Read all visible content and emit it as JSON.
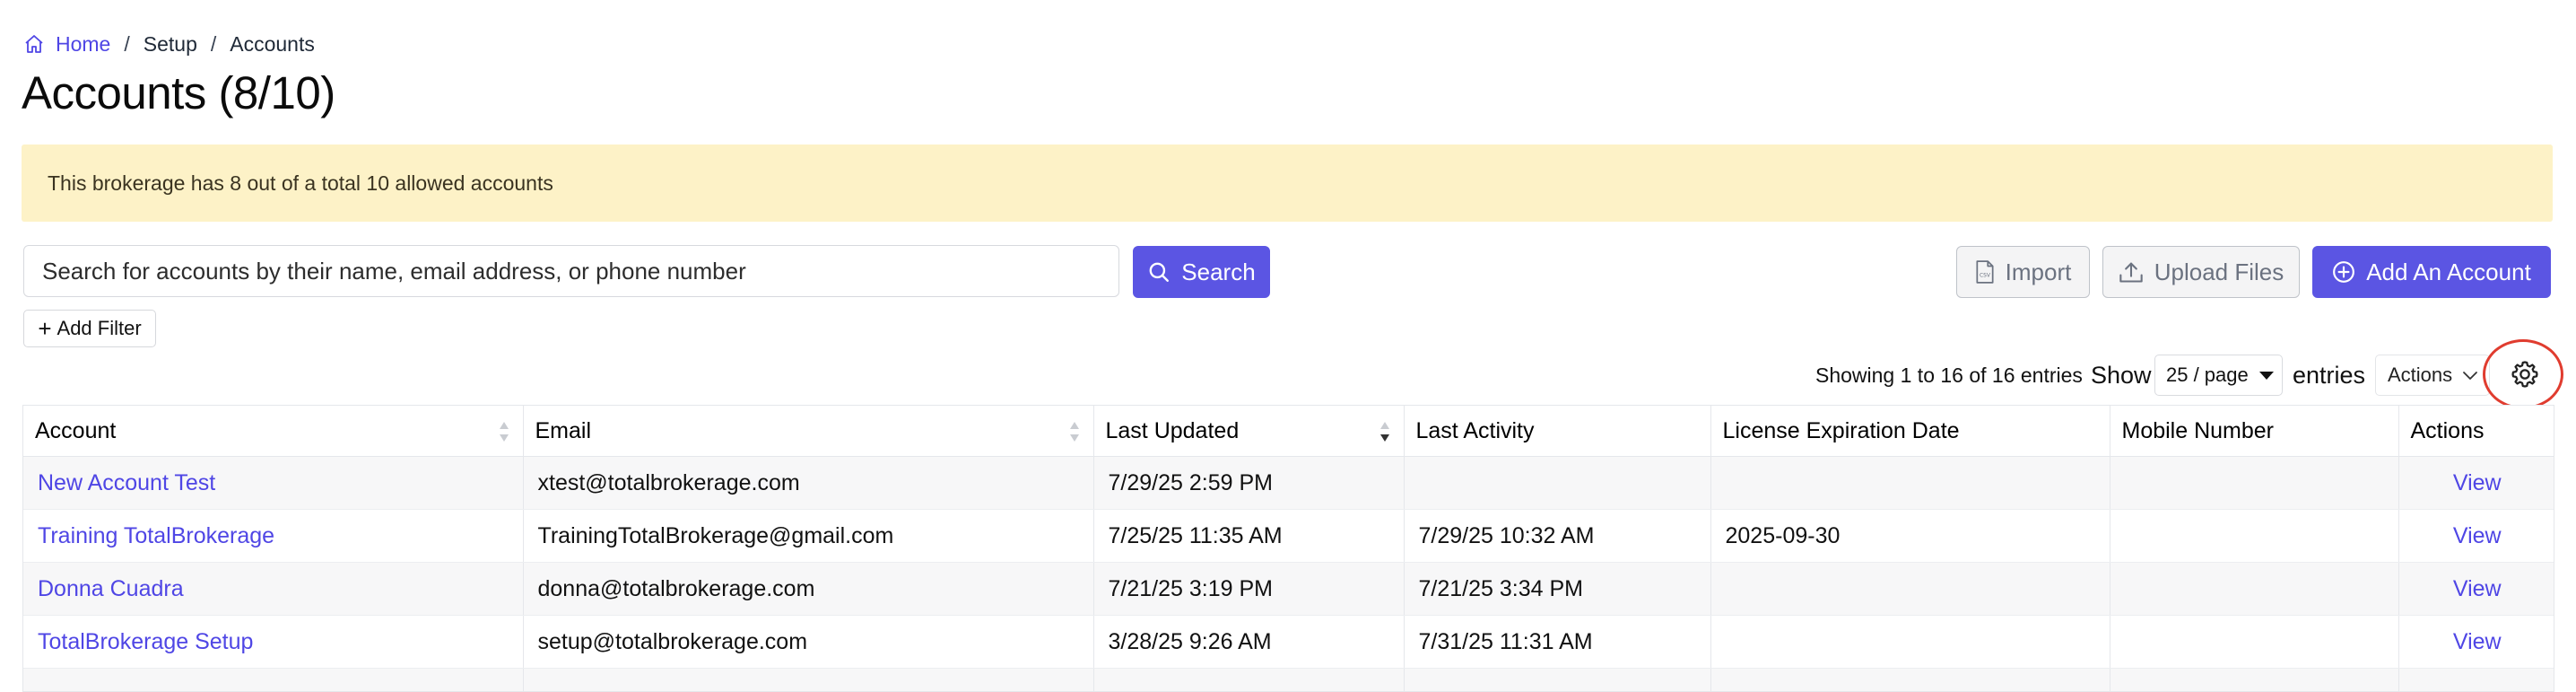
{
  "breadcrumb": {
    "home": "Home",
    "setup": "Setup",
    "current": "Accounts",
    "separator": "/"
  },
  "page": {
    "title": "Accounts (8/10)"
  },
  "notice": {
    "text": "This brokerage has 8 out of a total 10 allowed accounts",
    "bg_color": "#fdf2c7"
  },
  "search": {
    "placeholder": "Search for accounts by their name, email address, or phone number",
    "value": "",
    "button_label": "Search"
  },
  "buttons": {
    "import": "Import",
    "upload_files": "Upload Files",
    "add_account": "Add An Account",
    "add_filter": "Add Filter"
  },
  "toolbar": {
    "showing": "Showing 1 to 16 of 16 entries",
    "show": "Show",
    "page_size": "25 / page",
    "entries": "entries",
    "actions": "Actions"
  },
  "table": {
    "columns": [
      "Account",
      "Email",
      "Last Updated",
      "Last Activity",
      "License Expiration Date",
      "Mobile Number",
      "Actions"
    ],
    "rows": [
      {
        "account": "New Account Test",
        "email": "xtest@totalbrokerage.com",
        "last_updated": "7/29/25 2:59 PM",
        "last_activity": "",
        "license_expiration": "",
        "mobile": "",
        "action": "View"
      },
      {
        "account": "Training TotalBrokerage",
        "email": "TrainingTotalBrokerage@gmail.com",
        "last_updated": "7/25/25 11:35 AM",
        "last_activity": "7/29/25 10:32 AM",
        "license_expiration": "2025-09-30",
        "mobile": "",
        "action": "View"
      },
      {
        "account": "Donna Cuadra",
        "email": "donna@totalbrokerage.com",
        "last_updated": "7/21/25 3:19 PM",
        "last_activity": "7/21/25 3:34 PM",
        "license_expiration": "",
        "mobile": "",
        "action": "View"
      },
      {
        "account": "TotalBrokerage Setup",
        "email": "setup@totalbrokerage.com",
        "last_updated": "3/28/25 9:26 AM",
        "last_activity": "7/31/25 11:31 AM",
        "license_expiration": "",
        "mobile": "",
        "action": "View"
      }
    ]
  },
  "colors": {
    "primary": "#5b55e3",
    "link": "#4f46e5",
    "highlight_circle": "#e03c2f"
  },
  "icons": [
    "home-icon",
    "search-icon",
    "file-csv-icon",
    "upload-icon",
    "plus-circle-icon",
    "plus-icon",
    "caret-down-icon",
    "chevron-down-icon",
    "gear-icon",
    "sort-icon"
  ]
}
